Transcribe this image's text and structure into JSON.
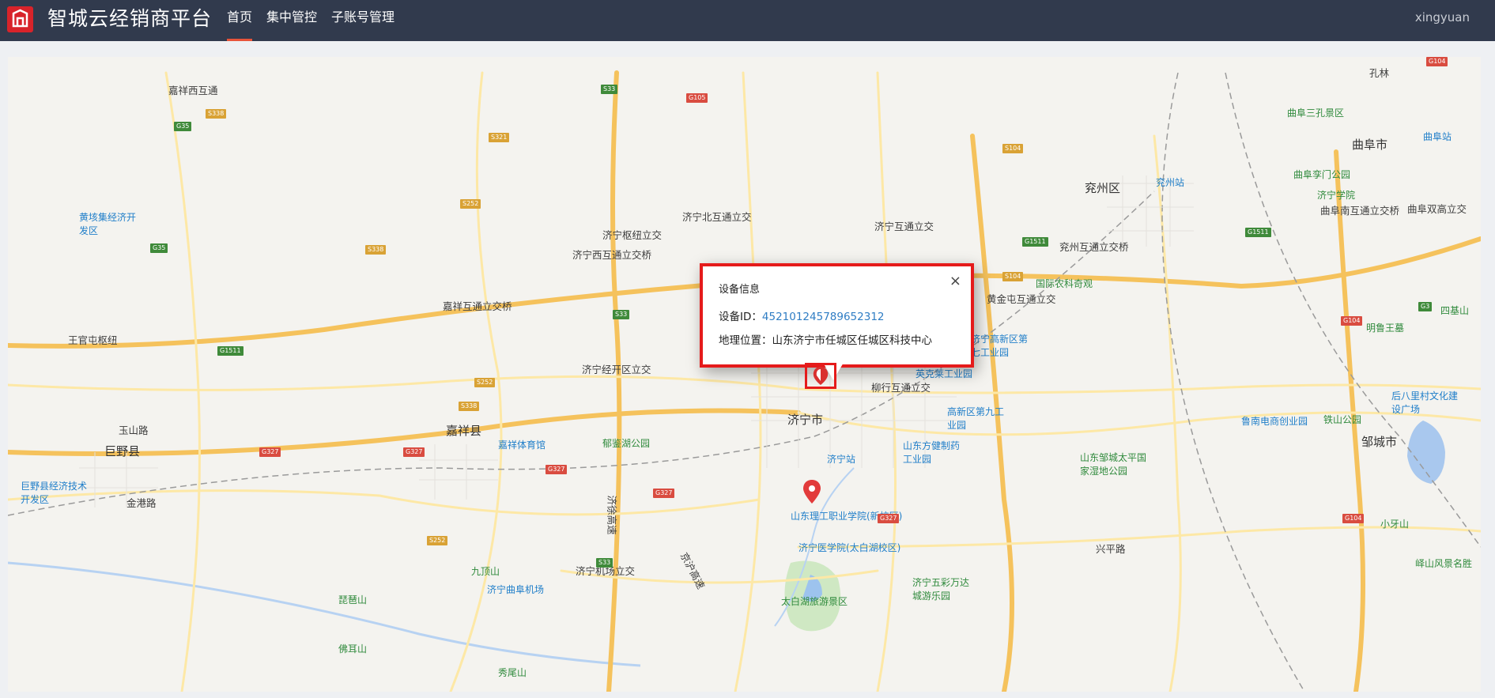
{
  "header": {
    "brand": "智城云经销商平台",
    "nav": [
      {
        "label": "首页",
        "active": true
      },
      {
        "label": "集中管控",
        "active": false
      },
      {
        "label": "子账号管理",
        "active": false
      }
    ],
    "user": "xingyuan"
  },
  "popup": {
    "title": "设备信息",
    "close": "×",
    "id_label": "设备ID：",
    "id_value": "452101245789652312",
    "loc_label": "地理位置：",
    "loc_value": "山东济宁市任城区任城区科技中心"
  },
  "map_labels": {
    "jining": "济宁市",
    "yanzhou": "兖州区",
    "qufu": "曲阜市",
    "jiaxiang": "嘉祥县",
    "juye": "巨野县",
    "zoucheng": "邹城市",
    "kongli": "孔林",
    "jiaxiangxi": "嘉祥西互通",
    "jiaxianghu": "嘉祥互通立交桥",
    "jiningshu": "济宁枢纽立交",
    "jiningbei": "济宁北互通立交",
    "jiningxi": "济宁西互通立交桥",
    "jiningjing": "济宁经开区立交",
    "jiningli": "济宁互通立交",
    "yanzhouhu": "兖州互通立交桥",
    "qufuhu": "曲阜南互通立交桥",
    "qufushuang": "曲阜双高立交",
    "huangjin": "黄金屯互通立交",
    "liuhang": "柳行互通立交",
    "jichang": "济宁机场立交",
    "wangguan": "王官屯枢纽",
    "yushan": "玉山路",
    "jingang": "金港路",
    "xingping": "兴平路",
    "jiningzhan": "济宁站",
    "yanzhouzhan": "兖州站",
    "qufuzhan": "曲阜站",
    "jiningairport": "济宁曲阜机场",
    "tiyuguan": "嘉祥体育馆",
    "yuanhu": "郁鉴湖公园",
    "taibaihu": "太白湖旅游景区",
    "ligong": "山东理工职业学院(新校区)",
    "yixue": "济宁医学院(太白湖校区)",
    "guoji": "国际农科奇观",
    "jiuding": "九顶山",
    "pipa": "琵琶山",
    "foer": "佛耳山",
    "xiuwei": "秀尾山",
    "tieshan": "铁山公园",
    "xiaoya": "小牙山",
    "zoucheng_wetland": "山东邹城太平国家湿地公园",
    "gaoxin7": "济宁高新区第七工业园",
    "gaoxin9": "高新区第九工业园",
    "fangjian": "山东方健制药工业园",
    "yingke": "英克莱工业园",
    "juye_kaifa": "巨野县经济技术开发区",
    "huangyi": "黄垓集经济开发区",
    "lunan": "鲁南电商创业园",
    "houbali": "后八里村文化建设广场",
    "jiningwucai": "济宁五彩万达城游乐园",
    "sanqu": "曲阜三孔景区",
    "qufuluan": "曲阜孪门公园",
    "jiningxueyuan": "济宁学院",
    "mingluwang": "明鲁王墓",
    "sishan": "四基山",
    "yishan": "峄山风景名胜",
    "jinghu": "京沪高速",
    "jixu": "济徐高速"
  }
}
